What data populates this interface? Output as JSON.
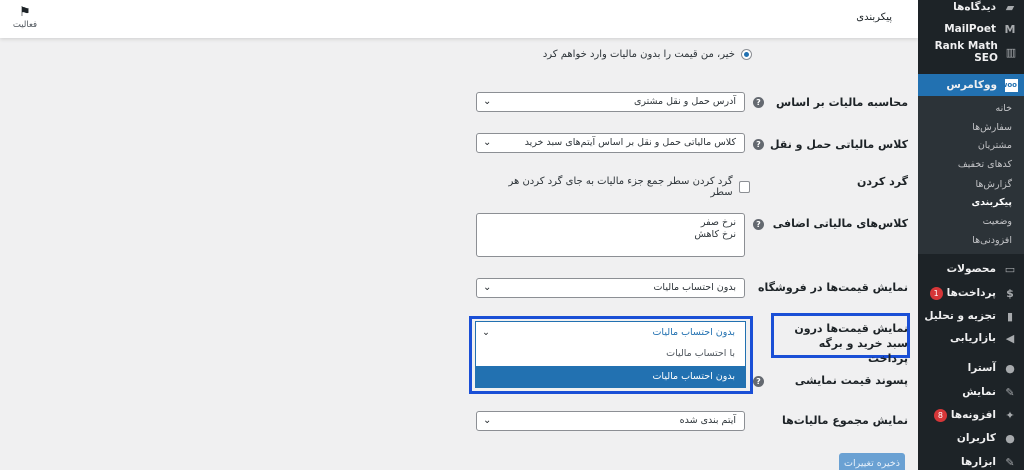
{
  "header": {
    "title": "پیکربندی",
    "activity_label": "فعالیت"
  },
  "sidebar": {
    "items": [
      {
        "label": "دیدگاه‌ها",
        "icon": "comment-icon"
      },
      {
        "label": "MailPoet",
        "icon": "mailpoet-icon"
      },
      {
        "label": "Rank Math SEO",
        "icon": "rankmath-icon"
      },
      {
        "label": "ووکامرس",
        "icon": "woo-icon"
      },
      {
        "label": "محصولات",
        "icon": "archive-icon"
      },
      {
        "label": "پرداخت‌ها",
        "icon": "payments-icon",
        "badge": "1"
      },
      {
        "label": "تجزیه و تحلیل",
        "icon": "analytics-icon"
      },
      {
        "label": "بازاریابی",
        "icon": "megaphone-icon"
      },
      {
        "label": "آسترا",
        "icon": "astra-icon"
      },
      {
        "label": "نمایش",
        "icon": "brush-icon"
      },
      {
        "label": "افزونه‌ها",
        "icon": "plugin-icon",
        "badge": "8"
      },
      {
        "label": "کاربران",
        "icon": "user-icon"
      },
      {
        "label": "ابزارها",
        "icon": "wrench-icon"
      }
    ],
    "submenu": [
      "خانه",
      "سفارش‌ها",
      "مشتریان",
      "کدهای تخفیف",
      "گزارش‌ها",
      "پیکربندی",
      "وضعیت",
      "افزودنی‌ها"
    ]
  },
  "form": {
    "radio_option": "خیر، من قیمت را بدون مالیات وارد خواهم کرد",
    "tax_based_on": {
      "label": "محاسبه مالیات بر اساس",
      "value": "آدرس حمل و نقل مشتری"
    },
    "shipping_tax_class": {
      "label": "کلاس مالیاتی حمل و نقل",
      "value": "کلاس مالیاتی حمل و نقل بر اساس آیتم‌های سبد خرید"
    },
    "rounding": {
      "label": "گرد کردن",
      "checkbox_text": "گرد کردن سطر جمع جزء مالیات به جای گرد کردن هر سطر"
    },
    "additional_tax_classes": {
      "label": "کلاس‌های مالیاتی اضافی",
      "lines": [
        "نرخ صفر",
        "نرخ کاهش"
      ]
    },
    "display_prices_shop": {
      "label": "نمایش قیمت‌ها در فروشگاه",
      "value": "بدون احتساب مالیات"
    },
    "display_prices_cart": {
      "label": "نمایش قیمت‌ها درون سبد خرید و برگه پرداخت",
      "value": "بدون احتساب مالیات",
      "options": [
        "با احتساب مالیات",
        "بدون احتساب مالیات"
      ],
      "selected_index": 1
    },
    "price_suffix": {
      "label": "پسوند قیمت نمایشی"
    },
    "display_tax_totals": {
      "label": "نمایش مجموع مالیات‌ها",
      "value": "آیتم بندی شده"
    },
    "save_label": "ذخیره تغییرات"
  },
  "colors": {
    "accent": "#2271b1",
    "highlight_frame": "#1a4fd6",
    "sidebar_bg": "#1d2327"
  }
}
